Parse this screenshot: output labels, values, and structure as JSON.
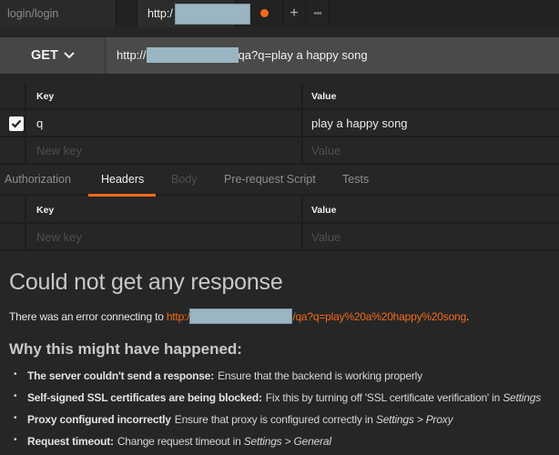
{
  "tabs": {
    "items": [
      {
        "label": "login/login",
        "active": false
      },
      {
        "label": "http:/",
        "active": true,
        "unsaved": true
      }
    ],
    "add_icon": "+",
    "more_icon": "•••"
  },
  "request": {
    "method": "GET",
    "url_prefix": "http://",
    "url_suffix": "qa?q=play a happy song"
  },
  "params": {
    "header_key": "Key",
    "header_value": "Value",
    "rows": [
      {
        "checked": true,
        "key": "q",
        "value": "play a happy song"
      }
    ],
    "new_key_placeholder": "New key",
    "new_value_placeholder": "Value"
  },
  "request_tabs": [
    {
      "label": "Authorization",
      "state": "normal"
    },
    {
      "label": "Headers",
      "state": "active"
    },
    {
      "label": "Body",
      "state": "disabled"
    },
    {
      "label": "Pre-request Script",
      "state": "normal"
    },
    {
      "label": "Tests",
      "state": "normal"
    }
  ],
  "headers": {
    "header_key": "Key",
    "header_value": "Value",
    "new_key_placeholder": "New key",
    "new_value_placeholder": "Value"
  },
  "response": {
    "title": "Could not get any response",
    "error_prefix": "There was an error connecting to ",
    "error_url_prefix": "http:/",
    "error_url_suffix": "/qa?q=play%20a%20happy%20song",
    "error_end": ".",
    "why_title": "Why this might have happened:",
    "reasons": [
      {
        "bold": "The server couldn't send a response:",
        "text": "Ensure that the backend is working properly",
        "italic": ""
      },
      {
        "bold": "Self-signed SSL certificates are being blocked:",
        "text": "Fix this by turning off 'SSL certificate verification' in ",
        "italic": "Settings"
      },
      {
        "bold": "Proxy configured incorrectly",
        "text": "Ensure that proxy is configured correctly in ",
        "italic": "Settings > Proxy"
      },
      {
        "bold": "Request timeout:",
        "text": "Change request timeout in ",
        "italic": "Settings > General"
      }
    ]
  },
  "colors": {
    "accent": "#f26b1d",
    "background": "#262626",
    "redaction": "#9bb5c3"
  }
}
